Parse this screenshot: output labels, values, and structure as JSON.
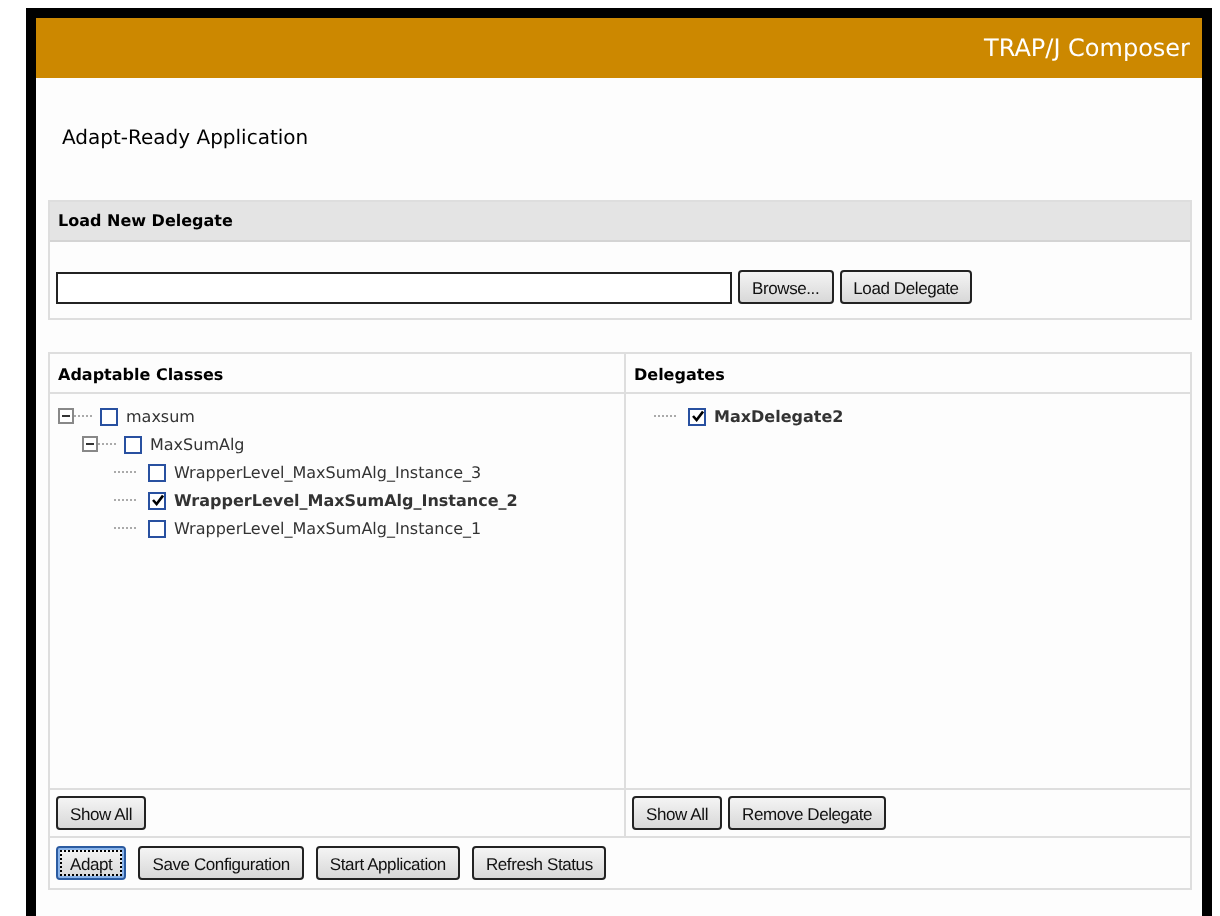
{
  "header": {
    "title": "TRAP/J Composer"
  },
  "page_title": "Adapt-Ready Application",
  "load_panel": {
    "title": "Load New Delegate",
    "buttons": [
      "Browse...",
      "Load Delegate"
    ]
  },
  "classes_panel": {
    "title": "Adaptable Classes",
    "tree": [
      {
        "label": "maxsum",
        "checked": false,
        "expanded": true,
        "children": [
          {
            "label": "MaxSumAlg",
            "checked": false,
            "expanded": true,
            "children": [
              {
                "label": "WrapperLevel_MaxSumAlg_Instance_3",
                "checked": false
              },
              {
                "label": "WrapperLevel_MaxSumAlg_Instance_2",
                "checked": true
              },
              {
                "label": "WrapperLevel_MaxSumAlg_Instance_1",
                "checked": false
              }
            ]
          }
        ]
      }
    ],
    "buttons": [
      "Show All"
    ]
  },
  "delegates_panel": {
    "title": "Delegates",
    "tree": [
      {
        "label": "MaxDelegate2",
        "checked": true
      }
    ],
    "buttons": [
      "Show All",
      "Remove Delegate"
    ]
  },
  "actions": [
    {
      "label": "Adapt",
      "focused": true
    },
    {
      "label": "Save Configuration",
      "focused": false
    },
    {
      "label": "Start Application",
      "focused": false
    },
    {
      "label": "Refresh Status",
      "focused": false
    }
  ]
}
